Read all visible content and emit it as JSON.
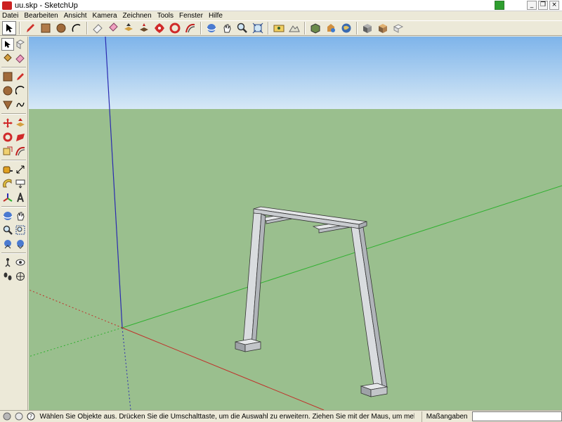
{
  "window": {
    "title": "uu.skp - SketchUp"
  },
  "menu": [
    {
      "label": "Datei"
    },
    {
      "label": "Bearbeiten"
    },
    {
      "label": "Ansicht"
    },
    {
      "label": "Kamera"
    },
    {
      "label": "Zeichnen"
    },
    {
      "label": "Tools"
    },
    {
      "label": "Fenster"
    },
    {
      "label": "Hilfe"
    }
  ],
  "toolbar": {
    "tools": [
      "select-arrow-icon",
      "pencil-icon",
      "rectangle-icon",
      "circle-icon",
      "arc-icon",
      "eraser-icon",
      "paint-bucket-icon",
      "push-pull-icon",
      "move-icon",
      "rotate-icon",
      "follow-me-icon",
      "orbit-icon",
      "pan-icon",
      "zoom-icon",
      "zoom-extents-icon",
      "add-location-icon",
      "google-earth-icon",
      "toggle-terrain-icon",
      "get-models-icon",
      "share-model-icon",
      "components-icon",
      "get-photo-texture-icon"
    ]
  },
  "status": {
    "hint": "Wählen Sie Objekte aus. Drücken Sie die Umschalttaste, um die Auswahl zu erweitern. Ziehen Sie mit der Maus, um mehrere Objekte",
    "measure_label": "Maßangaben",
    "measure_value": ""
  },
  "colors": {
    "sky_top": "#7eb4ea",
    "sky_bottom": "#d6e8f6",
    "ground": "#9abf8e",
    "axis_red": "#c0302a",
    "axis_green": "#2fb02f",
    "axis_blue": "#2a2ab0",
    "model_face": "#d9dcdf",
    "model_shade": "#b9bdc2"
  }
}
